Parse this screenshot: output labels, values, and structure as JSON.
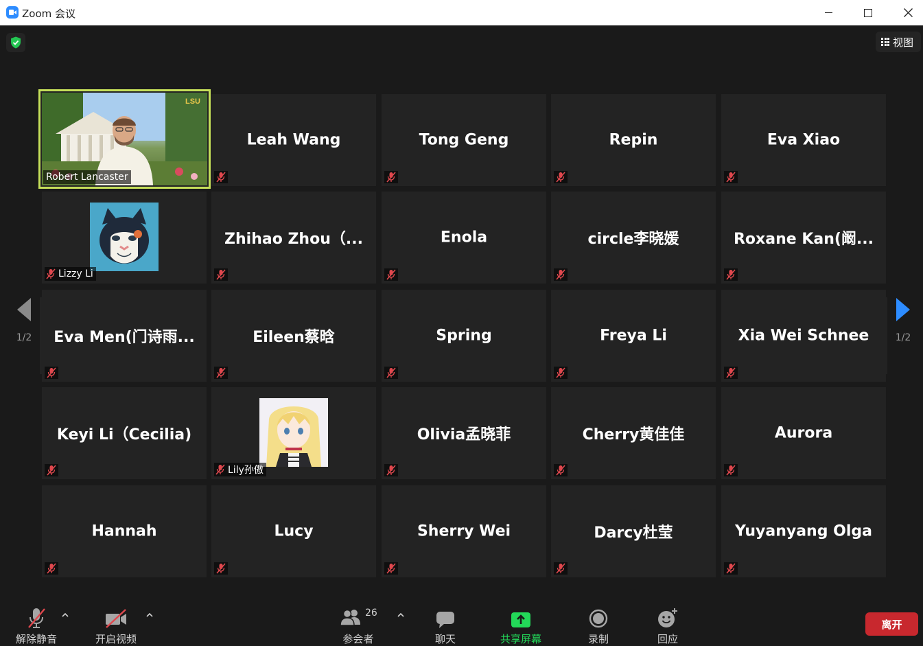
{
  "window": {
    "title": "Zoom 会议"
  },
  "header": {
    "view_label": "视图"
  },
  "pager": {
    "left": "1/2",
    "right": "1/2"
  },
  "tiles": [
    {
      "name": "Robert Lancaster",
      "type": "video"
    },
    {
      "name": "Leah Wang",
      "type": "name"
    },
    {
      "name": "Tong Geng",
      "type": "name"
    },
    {
      "name": "Repin",
      "type": "name"
    },
    {
      "name": "Eva Xiao",
      "type": "name"
    },
    {
      "name": "Lizzy Li",
      "type": "avatar-cat"
    },
    {
      "name": "Zhihao Zhou（...",
      "type": "name"
    },
    {
      "name": "Enola",
      "type": "name"
    },
    {
      "name": "circle李晓媛",
      "type": "name"
    },
    {
      "name": "Roxane Kan(阚...",
      "type": "name"
    },
    {
      "name": "Eva Men(门诗雨...",
      "type": "name"
    },
    {
      "name": "Eileen蔡晗",
      "type": "name"
    },
    {
      "name": "Spring",
      "type": "name"
    },
    {
      "name": "Freya Li",
      "type": "name"
    },
    {
      "name": "Xia Wei Schnee",
      "type": "name"
    },
    {
      "name": "Keyi Li（Cecilia)",
      "type": "name"
    },
    {
      "name": "Lily孙傲",
      "type": "avatar-anime"
    },
    {
      "name": "Olivia孟晓菲",
      "type": "name"
    },
    {
      "name": "Cherry黄佳佳",
      "type": "name"
    },
    {
      "name": "Aurora",
      "type": "name"
    },
    {
      "name": "Hannah",
      "type": "name"
    },
    {
      "name": "Lucy",
      "type": "name"
    },
    {
      "name": "Sherry Wei",
      "type": "name"
    },
    {
      "name": "Darcy杜莹",
      "type": "name"
    },
    {
      "name": "Yuyanyang Olga",
      "type": "name"
    }
  ],
  "video_overlay_text": "LSU",
  "toolbar": {
    "unmute": "解除静音",
    "start_video": "开启视频",
    "participants": "参会者",
    "participants_count": "26",
    "chat": "聊天",
    "share_screen": "共享屏幕",
    "record": "录制",
    "reactions": "回应",
    "leave": "离开"
  },
  "colors": {
    "active_speaker": "#c6e05a",
    "share_green": "#23d959",
    "leave_red": "#c8282e",
    "mute_red": "#e0484e"
  }
}
